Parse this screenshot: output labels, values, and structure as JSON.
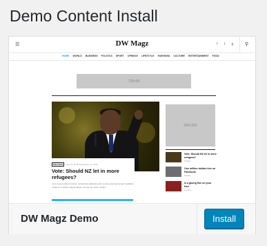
{
  "page": {
    "title": "Demo Content Install"
  },
  "theme": {
    "name": "DW Magz Demo",
    "install_label": "Install"
  },
  "preview": {
    "menu_icon": "menu-icon",
    "logo": "DW Magz",
    "social": "f  t  g",
    "search_icon": "search-icon",
    "nav": [
      "HOME",
      "WORLD",
      "BUSINESS",
      "POLITICS",
      "SPORT",
      "OPINION",
      "LIFESTYLE",
      "FASHIONS",
      "CULTURE",
      "ENTERTAINMENT",
      "FOOD"
    ],
    "ad_top": "728×90",
    "ad_side": "300×250",
    "featured": {
      "category": "POLITICS",
      "date": "July 12, 2016 September 12, 2016",
      "headline": "Vote: Should NZ let in more refugees?",
      "excerpt": "Lorem ipsum dolor sit amet, consectetur adipiscing elit, sed do eiusmod tempor incididunt ut labore et dolore magna aliqua. Ut enim ad minim veniam"
    },
    "side_list": [
      {
        "title": "Vote: Should NZ let in more refugees?",
        "category": "Politics",
        "thumb_color": "#4a3a1c"
      },
      {
        "title": "One million dollars free on Facebook",
        "category": "Politics",
        "thumb_color": "#6e6e6e"
      },
      {
        "title": "Is a gluing fine on your foot",
        "category": "Politics",
        "thumb_color": "#8c2020"
      }
    ]
  }
}
